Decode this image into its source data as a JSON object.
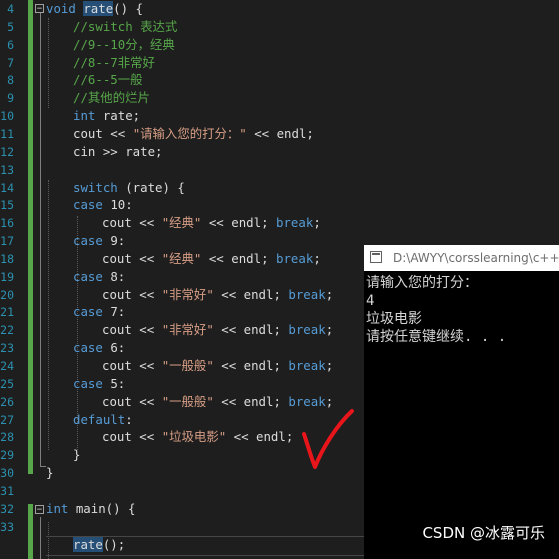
{
  "editor": {
    "line_numbers": [
      "4",
      "5",
      "6",
      "7",
      "8",
      "9",
      "10",
      "11",
      "12",
      "13",
      "14",
      "15",
      "16",
      "17",
      "18",
      "19",
      "20",
      "21",
      "22",
      "23",
      "24",
      "25",
      "26",
      "27",
      "28",
      "29",
      "30",
      "31",
      "32",
      "33"
    ],
    "fold_open": "−",
    "lines": [
      {
        "indent": 0,
        "tokens": [
          {
            "t": "void ",
            "c": "kw"
          },
          {
            "t": "rate",
            "c": "hl"
          },
          {
            "t": "() {",
            "c": ""
          }
        ]
      },
      {
        "indent": 1,
        "tokens": [
          {
            "t": "//switch 表达式",
            "c": "cm"
          }
        ]
      },
      {
        "indent": 1,
        "tokens": [
          {
            "t": "//9--10分，经典",
            "c": "cm"
          }
        ]
      },
      {
        "indent": 1,
        "tokens": [
          {
            "t": "//8--7非常好",
            "c": "cm"
          }
        ]
      },
      {
        "indent": 1,
        "tokens": [
          {
            "t": "//6--5一般",
            "c": "cm"
          }
        ]
      },
      {
        "indent": 1,
        "tokens": [
          {
            "t": "//其他的烂片",
            "c": "cm"
          }
        ]
      },
      {
        "indent": 1,
        "tokens": [
          {
            "t": "int ",
            "c": "kw"
          },
          {
            "t": "rate;",
            "c": ""
          }
        ]
      },
      {
        "indent": 1,
        "tokens": [
          {
            "t": "cout << ",
            "c": ""
          },
          {
            "t": "\"请输入您的打分：\"",
            "c": "st"
          },
          {
            "t": " << endl;",
            "c": ""
          }
        ]
      },
      {
        "indent": 1,
        "tokens": [
          {
            "t": "cin >> rate;",
            "c": ""
          }
        ]
      },
      {
        "indent": 1,
        "tokens": []
      },
      {
        "indent": 1,
        "tokens": [
          {
            "t": "switch ",
            "c": "kw"
          },
          {
            "t": "(rate) {",
            "c": ""
          }
        ]
      },
      {
        "indent": 1,
        "tokens": [
          {
            "t": "case ",
            "c": "kw"
          },
          {
            "t": "10:",
            "c": ""
          }
        ]
      },
      {
        "indent": 2,
        "tokens": [
          {
            "t": "cout << ",
            "c": ""
          },
          {
            "t": "\"经典\"",
            "c": "st"
          },
          {
            "t": " << endl; ",
            "c": ""
          },
          {
            "t": "break",
            "c": "kw"
          },
          {
            "t": ";",
            "c": ""
          }
        ]
      },
      {
        "indent": 1,
        "tokens": [
          {
            "t": "case ",
            "c": "kw"
          },
          {
            "t": "9:",
            "c": ""
          }
        ]
      },
      {
        "indent": 2,
        "tokens": [
          {
            "t": "cout << ",
            "c": ""
          },
          {
            "t": "\"经典\"",
            "c": "st"
          },
          {
            "t": " << endl; ",
            "c": ""
          },
          {
            "t": "break",
            "c": "kw"
          },
          {
            "t": ";",
            "c": ""
          }
        ]
      },
      {
        "indent": 1,
        "tokens": [
          {
            "t": "case ",
            "c": "kw"
          },
          {
            "t": "8:",
            "c": ""
          }
        ]
      },
      {
        "indent": 2,
        "tokens": [
          {
            "t": "cout << ",
            "c": ""
          },
          {
            "t": "\"非常好\"",
            "c": "st"
          },
          {
            "t": " << endl; ",
            "c": ""
          },
          {
            "t": "break",
            "c": "kw"
          },
          {
            "t": ";",
            "c": ""
          }
        ]
      },
      {
        "indent": 1,
        "tokens": [
          {
            "t": "case ",
            "c": "kw"
          },
          {
            "t": "7:",
            "c": ""
          }
        ]
      },
      {
        "indent": 2,
        "tokens": [
          {
            "t": "cout << ",
            "c": ""
          },
          {
            "t": "\"非常好\"",
            "c": "st"
          },
          {
            "t": " << endl; ",
            "c": ""
          },
          {
            "t": "break",
            "c": "kw"
          },
          {
            "t": ";",
            "c": ""
          }
        ]
      },
      {
        "indent": 1,
        "tokens": [
          {
            "t": "case ",
            "c": "kw"
          },
          {
            "t": "6:",
            "c": ""
          }
        ]
      },
      {
        "indent": 2,
        "tokens": [
          {
            "t": "cout << ",
            "c": ""
          },
          {
            "t": "\"一般般\"",
            "c": "st"
          },
          {
            "t": " << endl; ",
            "c": ""
          },
          {
            "t": "break",
            "c": "kw"
          },
          {
            "t": ";",
            "c": ""
          }
        ]
      },
      {
        "indent": 1,
        "tokens": [
          {
            "t": "case ",
            "c": "kw"
          },
          {
            "t": "5:",
            "c": ""
          }
        ]
      },
      {
        "indent": 2,
        "tokens": [
          {
            "t": "cout << ",
            "c": ""
          },
          {
            "t": "\"一般般\"",
            "c": "st"
          },
          {
            "t": " << endl; ",
            "c": ""
          },
          {
            "t": "break",
            "c": "kw"
          },
          {
            "t": ";",
            "c": ""
          }
        ]
      },
      {
        "indent": 1,
        "tokens": [
          {
            "t": "default",
            "c": "kw"
          },
          {
            "t": ":",
            "c": ""
          }
        ]
      },
      {
        "indent": 2,
        "tokens": [
          {
            "t": "cout << ",
            "c": ""
          },
          {
            "t": "\"垃圾电影\"",
            "c": "st"
          },
          {
            "t": " << endl;",
            "c": ""
          }
        ]
      },
      {
        "indent": 1,
        "tokens": [
          {
            "t": "}",
            "c": ""
          }
        ]
      },
      {
        "indent": 0,
        "tokens": [
          {
            "t": "}",
            "c": ""
          }
        ]
      },
      {
        "indent": 0,
        "tokens": []
      },
      {
        "indent": 0,
        "tokens": [
          {
            "t": "int ",
            "c": "kw"
          },
          {
            "t": "main() {",
            "c": ""
          }
        ]
      },
      {
        "indent": 0,
        "tokens": []
      },
      {
        "indent": 1,
        "tokens": [
          {
            "t": "rate",
            "c": "hl"
          },
          {
            "t": "();",
            "c": ""
          }
        ]
      }
    ]
  },
  "console": {
    "title": "D:\\AWYY\\corsslearning\\c++\\",
    "output": [
      "请输入您的打分：",
      "4",
      "垃圾电影",
      "请按任意键继续. . ."
    ]
  },
  "annotation": {
    "checkmark_color": "#e8161b"
  },
  "watermark": {
    "text": "CSDN @冰露可乐"
  },
  "colors": {
    "editor_bg": "#1e1e1e",
    "keyword": "#569cd6",
    "comment": "#57a64a",
    "string": "#d69d85",
    "line_number": "#2b91af",
    "highlight": "#264f78",
    "console_bg": "#000000"
  }
}
